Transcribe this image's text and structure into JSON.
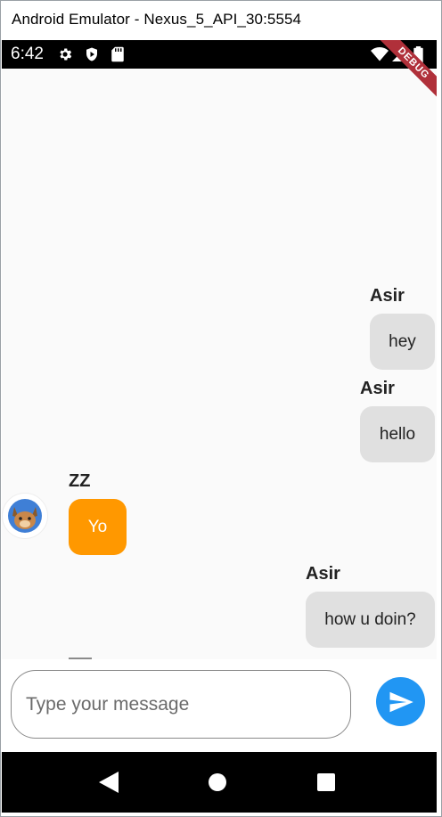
{
  "window": {
    "title": "Android Emulator - Nexus_5_API_30:5554"
  },
  "status_bar": {
    "time": "6:42",
    "left_icons": [
      "gear-icon",
      "shield-icon",
      "sd-card-icon"
    ],
    "right_icons": [
      "wifi-icon",
      "signal-icon",
      "battery-icon"
    ],
    "debug_banner": "DEBUG"
  },
  "messages": [
    {
      "sender": "Asir",
      "text": "hey",
      "side": "right"
    },
    {
      "sender": "Asir",
      "text": "hello",
      "side": "right"
    },
    {
      "sender": "ZZ",
      "text": "Yo",
      "side": "left",
      "avatar": "cartoon-avatar"
    },
    {
      "sender": "Asir",
      "text": "how u doin?",
      "side": "right"
    },
    {
      "sender": "ZZ",
      "text": "",
      "side": "left",
      "partially_visible": true
    }
  ],
  "colors": {
    "sent_bubble": "#e0e0e0",
    "received_bubble": "#ff9800",
    "send_button": "#2196f3",
    "debug_ribbon": "#b0303a"
  },
  "composer": {
    "placeholder": "Type your message",
    "value": ""
  },
  "nav_bar": {
    "buttons": [
      "back-icon",
      "home-icon",
      "recents-icon"
    ]
  }
}
